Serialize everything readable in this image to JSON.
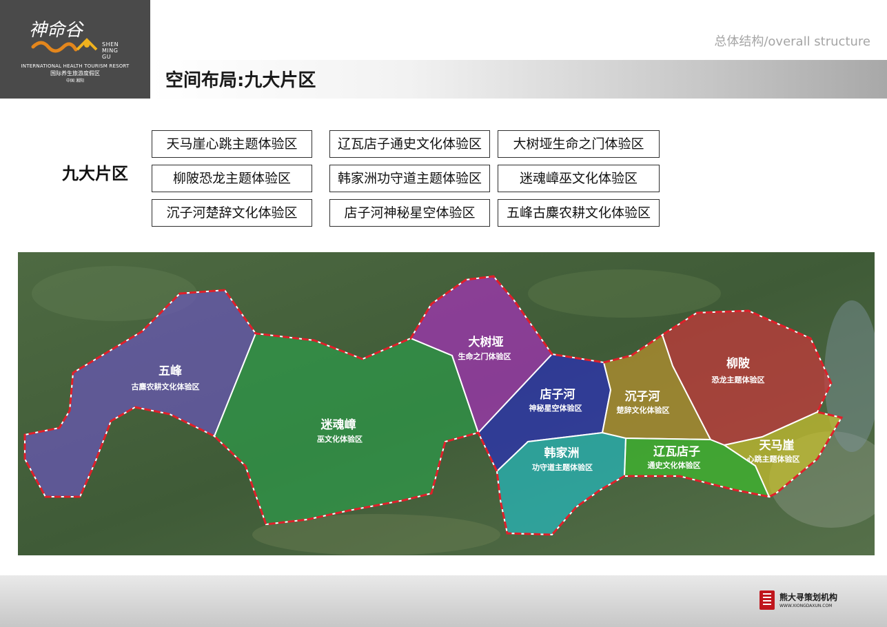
{
  "header": {
    "logo": {
      "brand_cn": "神命谷",
      "brand_en": "SHEN MING GU",
      "tagline_en": "INTERNATIONAL HEALTH TOURISM RESORT",
      "tagline_cn": "国际养生旅游度假区",
      "location": "中国 湘阳"
    },
    "section_label": "总体结构/overall structure",
    "page_title": "空间布局:九大片区"
  },
  "zones_heading": "九大片区",
  "zone_list": [
    "天马崖心跳主题体验区",
    "辽瓦店子通史文化体验区",
    "大树垭生命之门体验区",
    "柳陂恐龙主题体验区",
    "韩家洲功守道主题体验区",
    "迷魂嶂巫文化体验区",
    "沉子河楚辞文化体验区",
    "店子河神秘星空体验区",
    "五峰古麋农耕文化体验区"
  ],
  "map": {
    "boundary_color": "#e0202a",
    "zones": [
      {
        "name": "五峰",
        "sub": "古麋农耕文化体验区",
        "color": "#6a56b8"
      },
      {
        "name": "迷魂嶂",
        "sub": "巫文化体验区",
        "color": "#2e9a4a"
      },
      {
        "name": "大树垭",
        "sub": "生命之门体验区",
        "color": "#a532b8"
      },
      {
        "name": "店子河",
        "sub": "神秘星空体验区",
        "color": "#2a2fb8"
      },
      {
        "name": "韩家洲",
        "sub": "功守道主题体验区",
        "color": "#26b8bc"
      },
      {
        "name": "沉子河",
        "sub": "楚辞文化体验区",
        "color": "#b8922e"
      },
      {
        "name": "辽瓦店子",
        "sub": "通史文化体验区",
        "color": "#3fbd2e"
      },
      {
        "name": "柳陂",
        "sub": "恐龙主题体验区",
        "color": "#c8383a"
      },
      {
        "name": "天马崖",
        "sub": "心跳主题体验区",
        "color": "#c9c02e"
      }
    ]
  },
  "footer": {
    "company": "熊大寻策划机构",
    "url": "WWW.XIONGDAXUN.COM"
  }
}
